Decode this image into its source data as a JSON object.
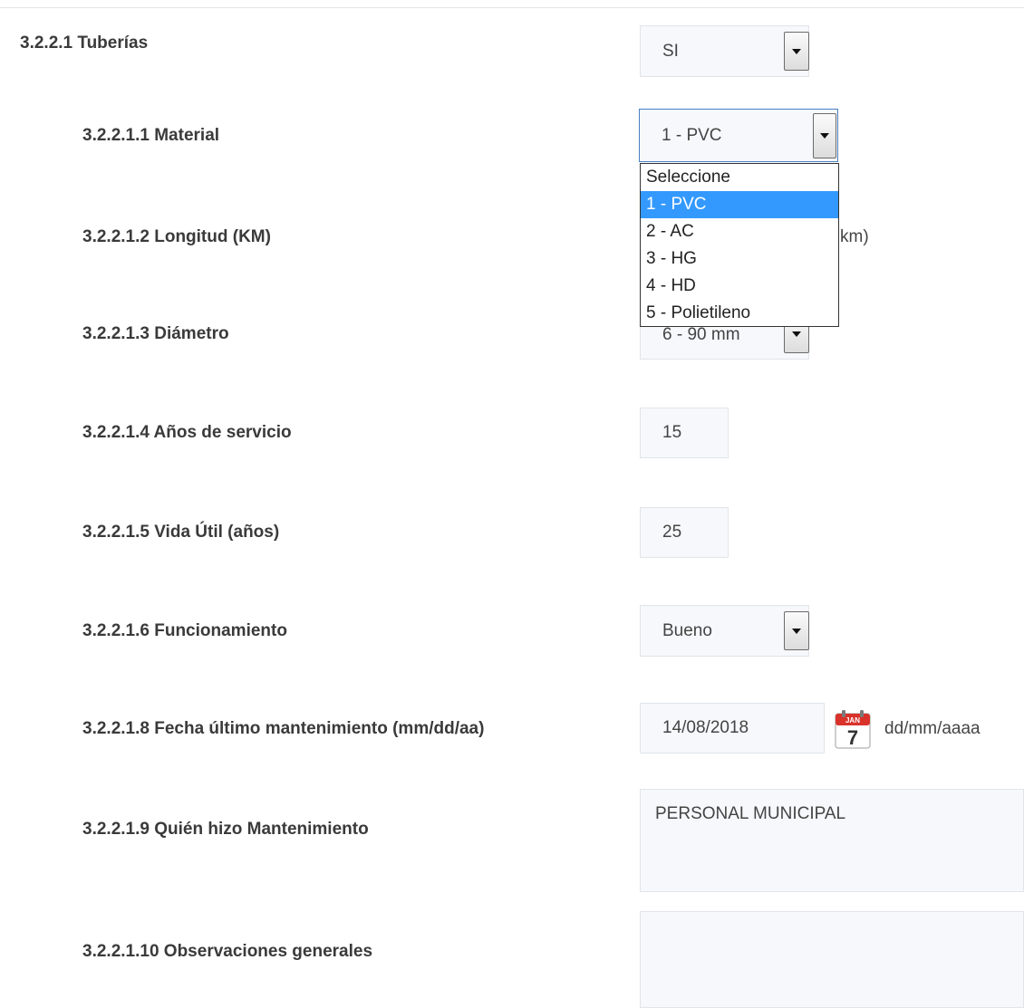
{
  "fields": {
    "tuberias": {
      "label": "3.2.2.1 Tuberías",
      "value": "SI"
    },
    "material": {
      "label": "3.2.2.1.1 Material",
      "value": "1 - PVC",
      "options": [
        "Seleccione",
        "1 - PVC",
        "2 - AC",
        "3 - HG",
        "4 - HD",
        "5 - Polietileno"
      ],
      "selected_index": 1
    },
    "longitud": {
      "label": "3.2.2.1.2 Longitud (KM)",
      "unit_fragment": "km)"
    },
    "diametro": {
      "label": "3.2.2.1.3 Diámetro",
      "value": "6 - 90 mm"
    },
    "anos_servicio": {
      "label": "3.2.2.1.4 Años de servicio",
      "value": "15"
    },
    "vida_util": {
      "label": "3.2.2.1.5 Vida Útil (años)",
      "value": "25"
    },
    "funcionamiento": {
      "label": "3.2.2.1.6 Funcionamiento",
      "value": "Bueno"
    },
    "fecha_mantenimiento": {
      "label": "3.2.2.1.8 Fecha último mantenimiento (mm/dd/aa)",
      "value": "14/08/2018",
      "format_hint": "dd/mm/aaaa",
      "calendar_month": "JAN",
      "calendar_day": "7"
    },
    "quien_mantenimiento": {
      "label": "3.2.2.1.9 Quién hizo Mantenimiento",
      "value": "PERSONAL MUNICIPAL"
    },
    "observaciones": {
      "label": "3.2.2.1.10 Observaciones generales",
      "value": ""
    }
  }
}
